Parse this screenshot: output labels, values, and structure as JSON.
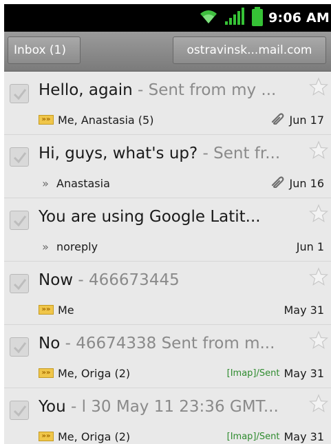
{
  "status_bar": {
    "time": "9:06 AM",
    "icons": [
      "wifi-icon",
      "signal-icon",
      "battery-icon"
    ]
  },
  "header": {
    "folder_button": "Inbox (1)",
    "account_button": "ostravinsk...mail.com"
  },
  "messages": [
    {
      "subject": "Hello, again",
      "snippet": " - Sent from my ...",
      "sender": "Me, Anastasia (5)",
      "indicator": "double",
      "attachment": true,
      "label": "",
      "date": "Jun 17"
    },
    {
      "subject": "Hi, guys, what's up?",
      "snippet": " - Sent fr...",
      "sender": "Anastasia",
      "indicator": "single",
      "attachment": true,
      "label": "",
      "date": "Jun 16"
    },
    {
      "subject": "You are using Google Latit...",
      "snippet": "",
      "sender": "noreply",
      "indicator": "single",
      "attachment": false,
      "label": "",
      "date": "Jun 1"
    },
    {
      "subject": "Now",
      "snippet": " - 466673445",
      "sender": "Me",
      "indicator": "double",
      "attachment": false,
      "label": "",
      "date": "May 31"
    },
    {
      "subject": "No",
      "snippet": " - 46674338 Sent from m...",
      "sender": "Me, Origa (2)",
      "indicator": "double",
      "attachment": false,
      "label": "[Imap]/Sent",
      "date": "May 31"
    },
    {
      "subject": "You",
      "snippet": " - l 30 May 11 23:36 GMT...",
      "sender": "Me, Origa (2)",
      "indicator": "double",
      "attachment": false,
      "label": "[Imap]/Sent",
      "date": "May 31"
    }
  ],
  "colors": {
    "label_green": "#2e8b2e",
    "indicator_yellow": "#f0c64a",
    "snippet_gray": "#8a8a8a"
  }
}
